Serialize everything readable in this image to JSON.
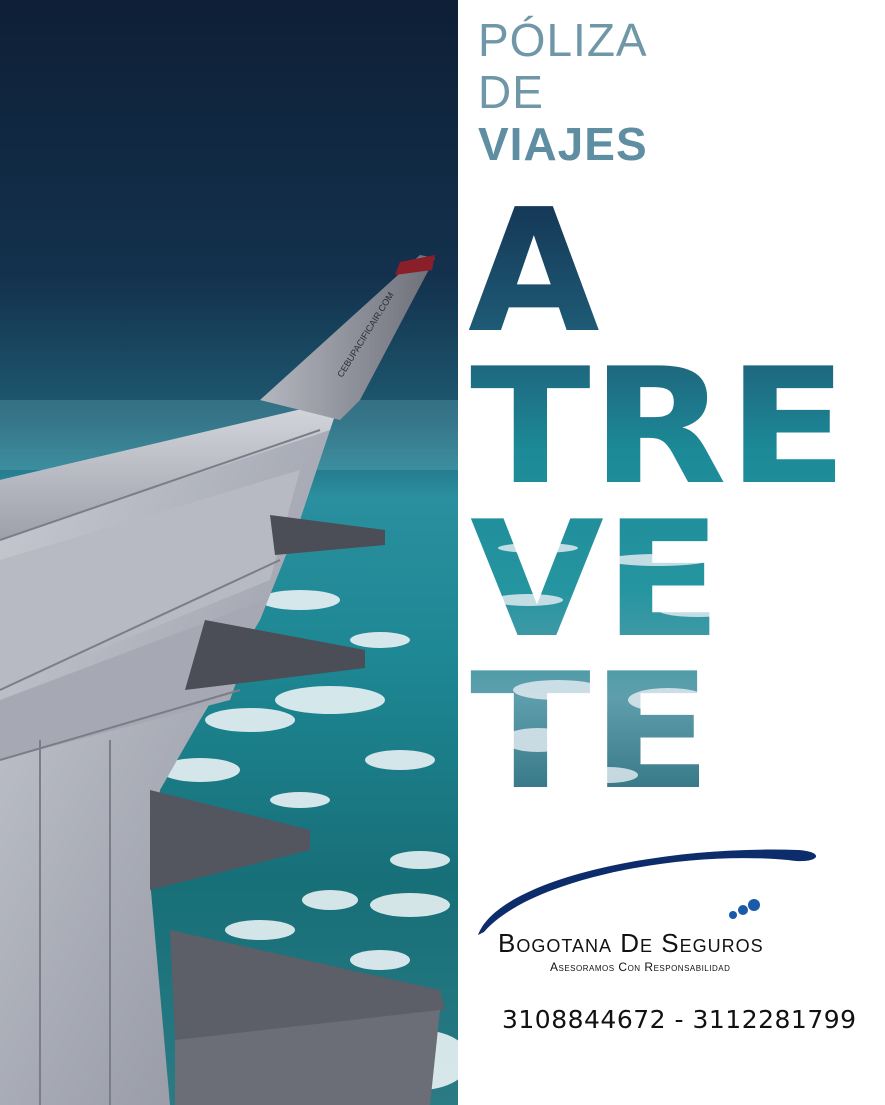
{
  "ad": {
    "title_line1": "PÓLIZA",
    "title_line2": "DE",
    "title_line3": "VIAJES",
    "slogan_rows": [
      "A",
      "TRE",
      "VE",
      "TE"
    ],
    "wing_print": "CEBUPACIFICAIR.COM",
    "photo_subject": "airplane-wing-over-clouds"
  },
  "brand": {
    "name": "Bogotana De Seguros",
    "tagline": "Asesoramos Con Responsabilidad",
    "color_primary": "#0d2c6b",
    "color_accent": "#1a5aa8"
  },
  "contact": {
    "phones": "3108844672 - 3112281799"
  },
  "colors": {
    "title": "#6f97a8",
    "sky_dark": "#0e2138",
    "sea_teal": "#147f8a"
  }
}
